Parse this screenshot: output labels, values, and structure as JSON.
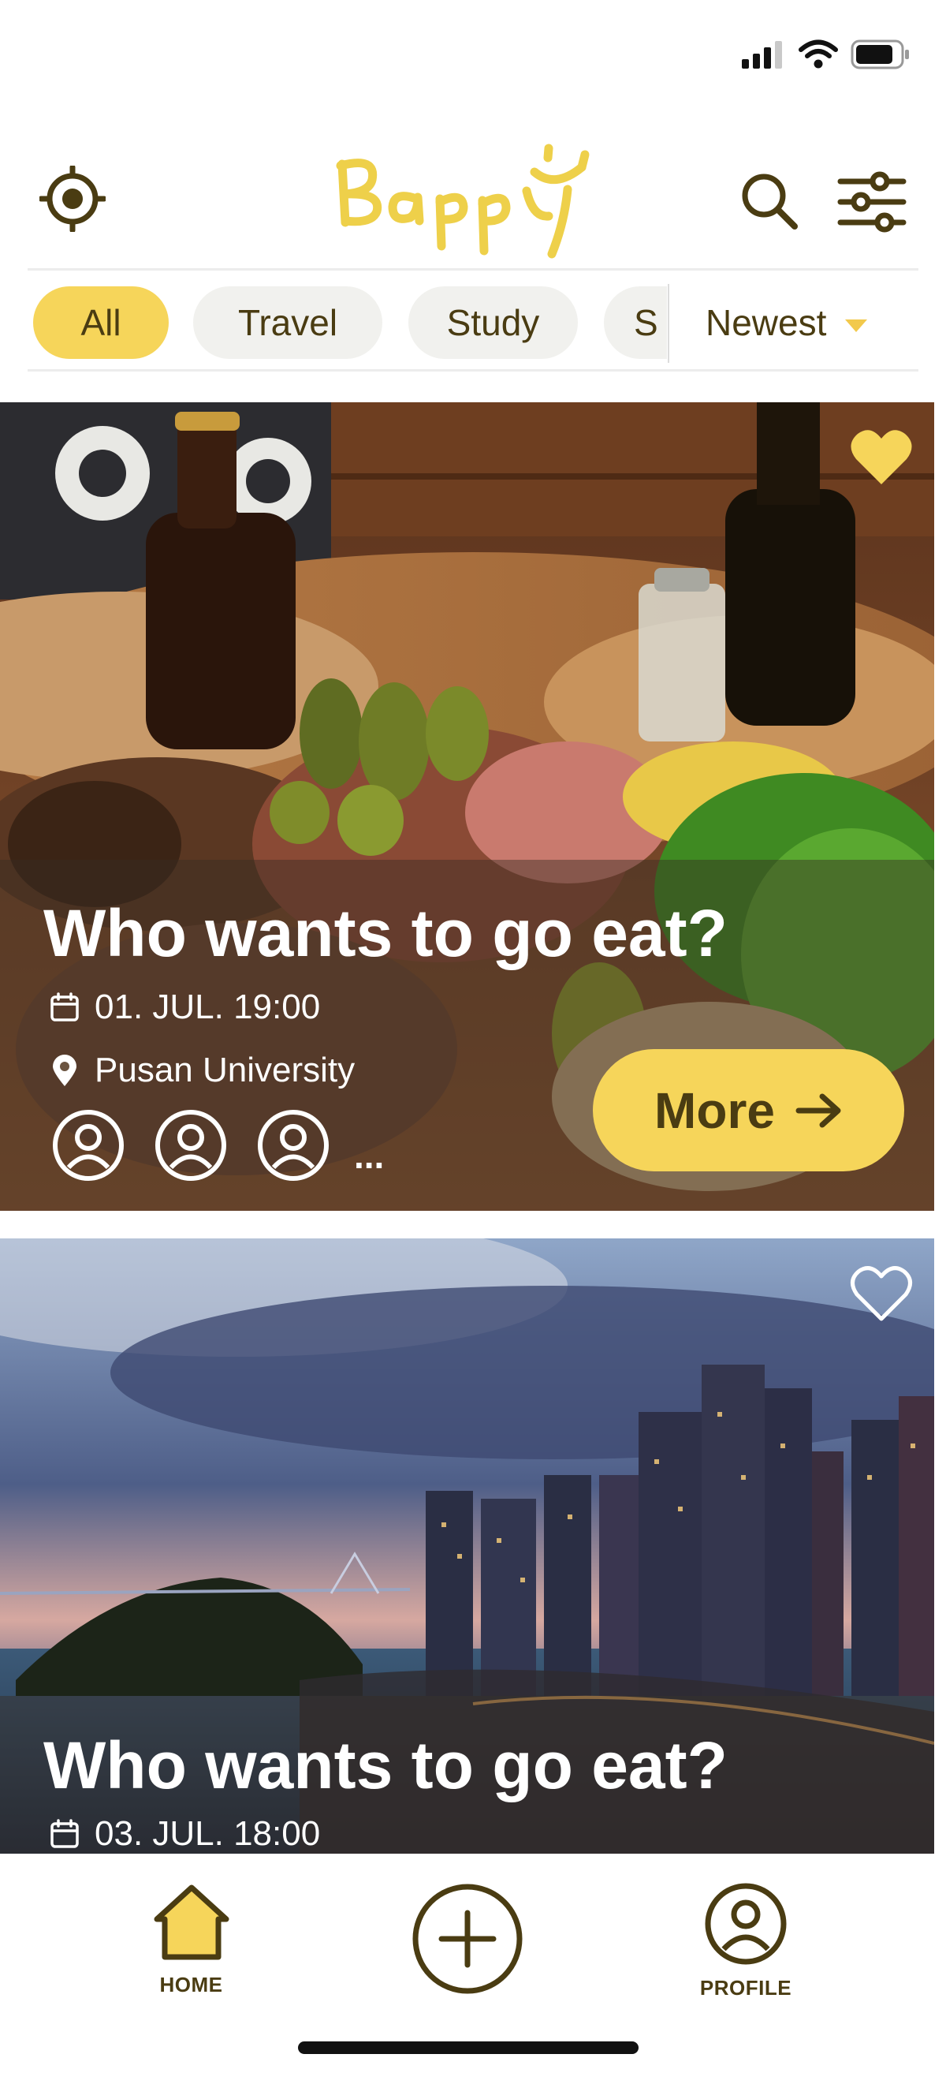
{
  "status_bar": {
    "icons": [
      "signal-icon",
      "wifi-icon",
      "battery-icon"
    ]
  },
  "header": {
    "logo_text": "Bappy",
    "icons": [
      "location-target-icon",
      "search-icon",
      "filter-sliders-icon"
    ]
  },
  "categories": {
    "chips": [
      {
        "label": "All",
        "active": true
      },
      {
        "label": "Travel",
        "active": false
      },
      {
        "label": "Study",
        "active": false
      },
      {
        "label": "S",
        "active": false
      }
    ],
    "sort_label": "Newest"
  },
  "cards": [
    {
      "title": "Who wants to go eat?",
      "date": "01. JUL. 19:00",
      "location": "Pusan University",
      "favorited": true,
      "more_label": "More",
      "more_suffix": "...",
      "participant_icons": [
        "user-icon",
        "user-icon",
        "user-icon"
      ]
    },
    {
      "title": "Who wants to go eat?",
      "date": "03. JUL. 18:00",
      "favorited": false
    }
  ],
  "bottom_nav": {
    "home_label": "HOME",
    "profile_label": "PROFILE"
  },
  "colors": {
    "accent": "#f6d55a",
    "logo": "#eed04a",
    "text_brown": "#4a3c12",
    "chip_bg": "#f1f1ee"
  }
}
